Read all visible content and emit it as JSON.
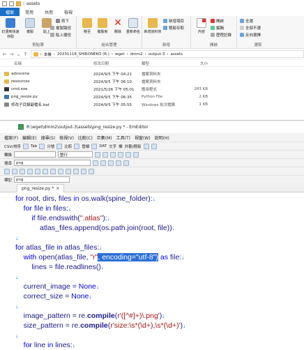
{
  "explorer": {
    "title": "assets",
    "tabs": [
      "檔案",
      "常用",
      "共用",
      "檢視"
    ],
    "ribbon": {
      "clipboard": {
        "label": "剪貼簿",
        "pin": "釘選到快速存取",
        "copy": "複製",
        "paste": "貼上",
        "cut": "剪下",
        "copy_path": "複製路徑",
        "paste_shortcut": "貼上捷徑"
      },
      "organize": {
        "label": "組合管理",
        "move": "移至",
        "copy_to": "複製到",
        "delete": "刪除",
        "rename": "重新命名"
      },
      "new": {
        "label": "新增",
        "folder": "新增資料夾",
        "new_item": "新增項目",
        "easy_access": "輕鬆存取"
      },
      "open": {
        "label": "開啟",
        "props": "內容",
        "open": "開啟",
        "edit": "編輯",
        "history": "歷程記錄"
      },
      "select": {
        "label": "選取",
        "all": "全選",
        "none": "全部不選",
        "invert": "反向選擇"
      }
    },
    "breadcrumbs": [
      "本機",
      "20231118_SHIRONEKO (R:)",
      "wget",
      "dmm2",
      "output-3",
      "assets"
    ],
    "columns": [
      "名稱",
      "修改日期",
      "類型",
      "大小"
    ],
    "files": [
      {
        "name": "advscene",
        "date": "2024/9/5 下午 04:21",
        "type": "檔案資料夾",
        "size": ""
      },
      {
        "name": "resources",
        "date": "2024/9/5 下午 06:10",
        "type": "檔案資料夾",
        "size": ""
      },
      {
        "name": "cmd.exe",
        "date": "2021/5/26 下午 05:01",
        "type": "應用程式",
        "size": "283 KB"
      },
      {
        "name": "png_resize.py",
        "date": "2024/9/5 下午 06:35",
        "type": "Python File",
        "size": "2 KB"
      },
      {
        "name": "修改子目錄副檔名.bat",
        "date": "2024/9/5 下午 05:55",
        "type": "Windows 批次檔案",
        "size": "1 KB"
      }
    ]
  },
  "editor": {
    "title": "R:\\wget\\dmm2\\output-3\\assets\\png_resize.py * - EmEditor",
    "menu": [
      "檔案(F)",
      "編輯(E)",
      "搜尋(S)",
      "檢視(V)",
      "比較(C)",
      "巨集(M)",
      "工具(T)",
      "視窗(W)",
      "說明(H)"
    ],
    "toolbar1": [
      "CSV/排序",
      "|",
      "Tab",
      "分號",
      "比較",
      "管線",
      "DAT",
      "文字",
      "欄",
      "外觀/輕鬆",
      "外觀"
    ],
    "toolbar2_label": "轉錄",
    "toolbar2_combo": "整行",
    "toolbar3_label": "標記",
    "toolbar3_combo": "png",
    "search_label": "搜尋",
    "search_value": "png",
    "tab": "png_resize.py *",
    "code": [
      "for root, dirs, files in os.walk(spine_folder):",
      "    for file in files:",
      "        if file.endswith(\".atlas\"):",
      "            atlas_files.append(os.path.join(root, file))",
      "",
      "for atlas_file in atlas_files:",
      "    with open(atlas_file, \"r\", encoding=\"utf-8\") as file:",
      "        lines = file.readlines()",
      "",
      "    current_image = None",
      "    correct_size = None",
      "",
      "    image_pattern = re.compile(r'([^#]+)\\.png')",
      "    size_pattern = re.compile(r'size:\\s*(\\d+),\\s*(\\d+)')",
      "",
      "    for line in lines:"
    ],
    "line_number": "5",
    "colors": {
      "accent": "#1a6fc9",
      "selection": "#2b6fd6",
      "keyword": "#0000ff",
      "string": "#a31515"
    }
  }
}
